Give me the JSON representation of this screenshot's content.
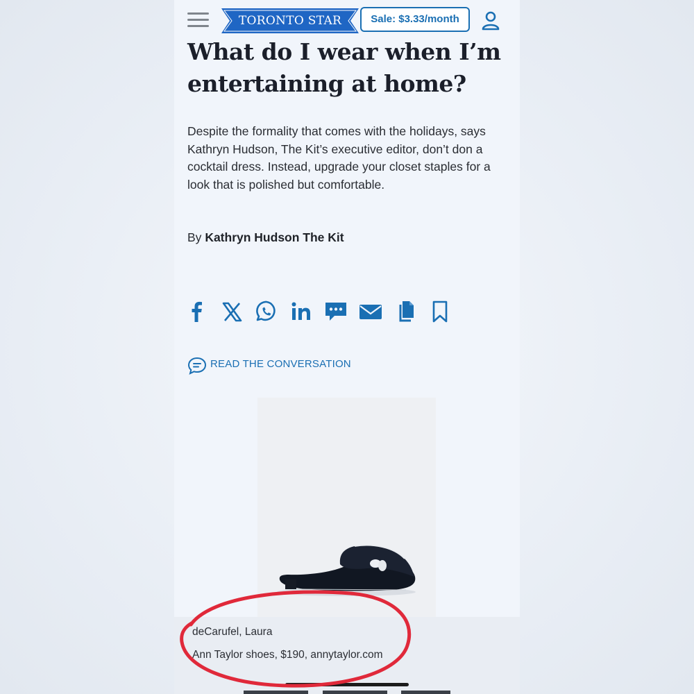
{
  "header": {
    "logo_text": "TORONTO STAR",
    "sale_label": "Sale: $3.33/month"
  },
  "article": {
    "headline": "What do I wear when I’m entertaining at home?",
    "dek": "Despite the formality that comes with the holidays, says Kathryn Hudson, The Kit’s executive editor, don’t don a cocktail dress. Instead, upgrade your closet staples for a look that is polished but comfortable.",
    "byline_prefix": "By",
    "byline_author": "Kathryn Hudson The Kit"
  },
  "share": {
    "icons": [
      "facebook-icon",
      "x-icon",
      "whatsapp-icon",
      "linkedin-icon",
      "sms-icon",
      "email-icon",
      "copy-link-icon",
      "bookmark-icon"
    ]
  },
  "conversation": {
    "label": "READ THE CONVERSATION"
  },
  "photo": {
    "credit": "deCarufel, Laura",
    "caption": "Ann Taylor shoes, $190, annytaylor.com"
  },
  "colors": {
    "accent": "#1a6fb3",
    "logo_blue": "#1f66c4",
    "annotation_red": "#e0293a",
    "page_bg": "#f1f5fb"
  }
}
